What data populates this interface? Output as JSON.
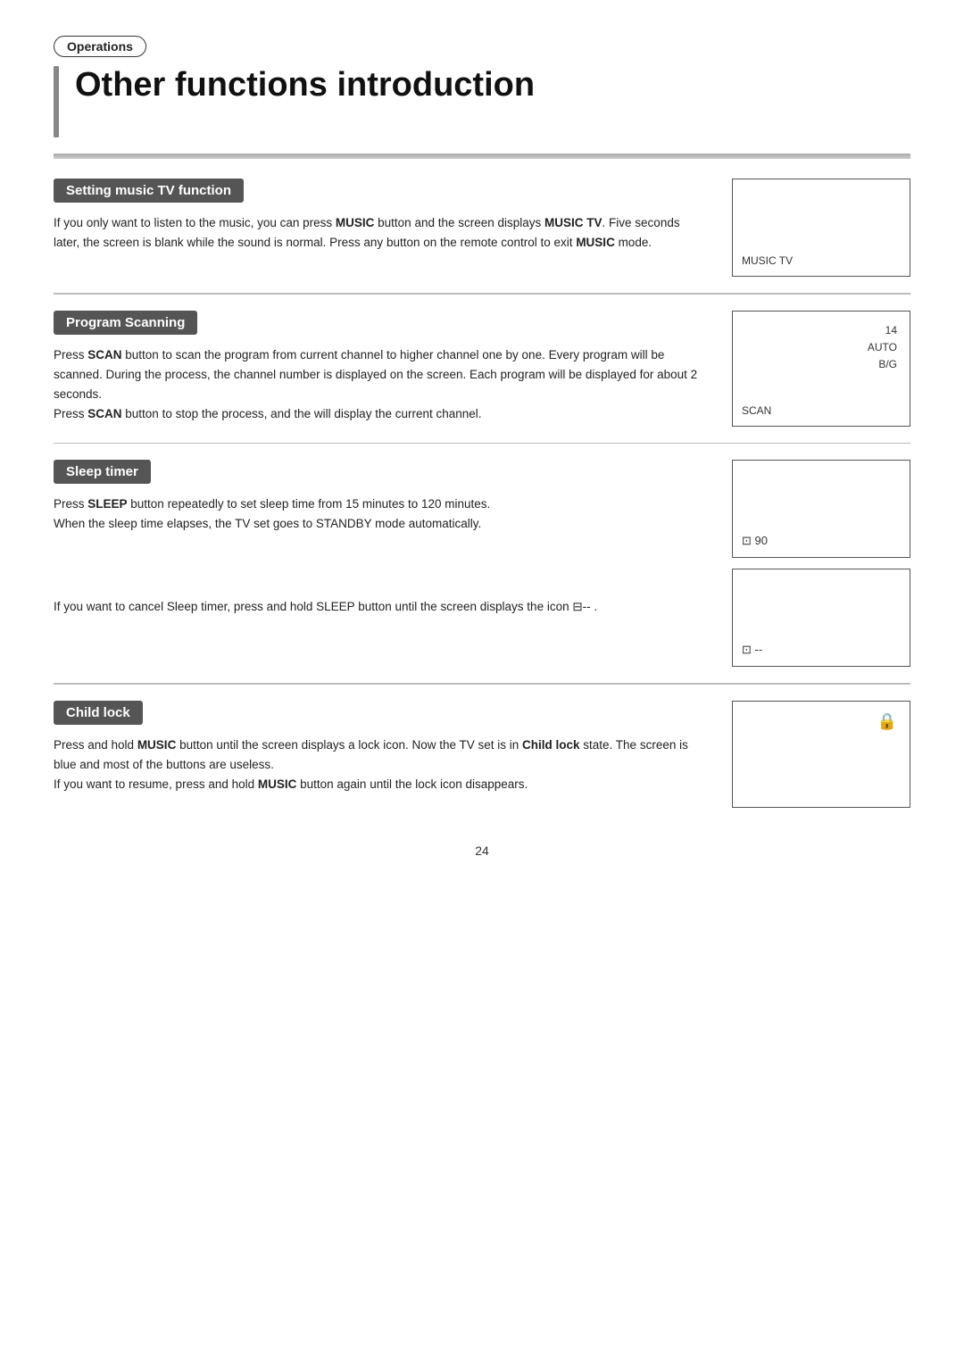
{
  "badge": {
    "label": "Operations"
  },
  "page_title": "Other functions introduction",
  "sections": [
    {
      "id": "setting-music-tv",
      "header": "Setting music TV function",
      "body_html": "If you only want to listen to the music, you can press <b>MUSIC</b> button and the screen displays <b>MUSIC TV</b>. Five seconds later, the screen is blank while the sound is normal. Press any button on the remote control to exit <b>MUSIC</b> mode.",
      "screen_boxes": [
        {
          "label_bottom_left": "MUSIC TV",
          "label_right": "",
          "icon": ""
        }
      ]
    },
    {
      "id": "program-scanning",
      "header": "Program Scanning",
      "body_html": "Press <b>SCAN</b> button to scan the program from current channel to higher channel one by one. Every program will be scanned. During the process, the channel number is displayed on the screen. Each program will be displayed for about 2 seconds.<br>Press <b>SCAN</b> button to stop the process, and the will display the current channel.",
      "screen_boxes": [
        {
          "label_bottom_left": "SCAN",
          "label_right": "14\nAUTO\nB/G",
          "icon": ""
        }
      ]
    },
    {
      "id": "sleep-timer",
      "header": "Sleep timer",
      "body_1": "Press SLEEP button repeatedly to set sleep time from 15 minutes to 120 minutes.\nWhen the sleep time elapses, the TV set goes to STANDBY mode automatically.",
      "body_2": "If you want to cancel Sleep timer, press and hold SLEEP button until the screen displays the icon",
      "screen_box_1_label": "⊡ 90",
      "screen_box_2_label": "⊡ --"
    },
    {
      "id": "child-lock",
      "header": "Child lock",
      "body_html": "Press and hold <b>MUSIC</b> button until the screen displays a lock icon. Now the TV set is in <b>Child lock</b> state. The screen is blue and most of the buttons are useless.<br>If you want to resume, press and hold <b>MUSIC</b> button again until the lock icon disappears.",
      "screen_boxes": [
        {
          "label_bottom_left": "",
          "label_right": "",
          "icon": "🔒"
        }
      ]
    }
  ],
  "page_number": "24"
}
